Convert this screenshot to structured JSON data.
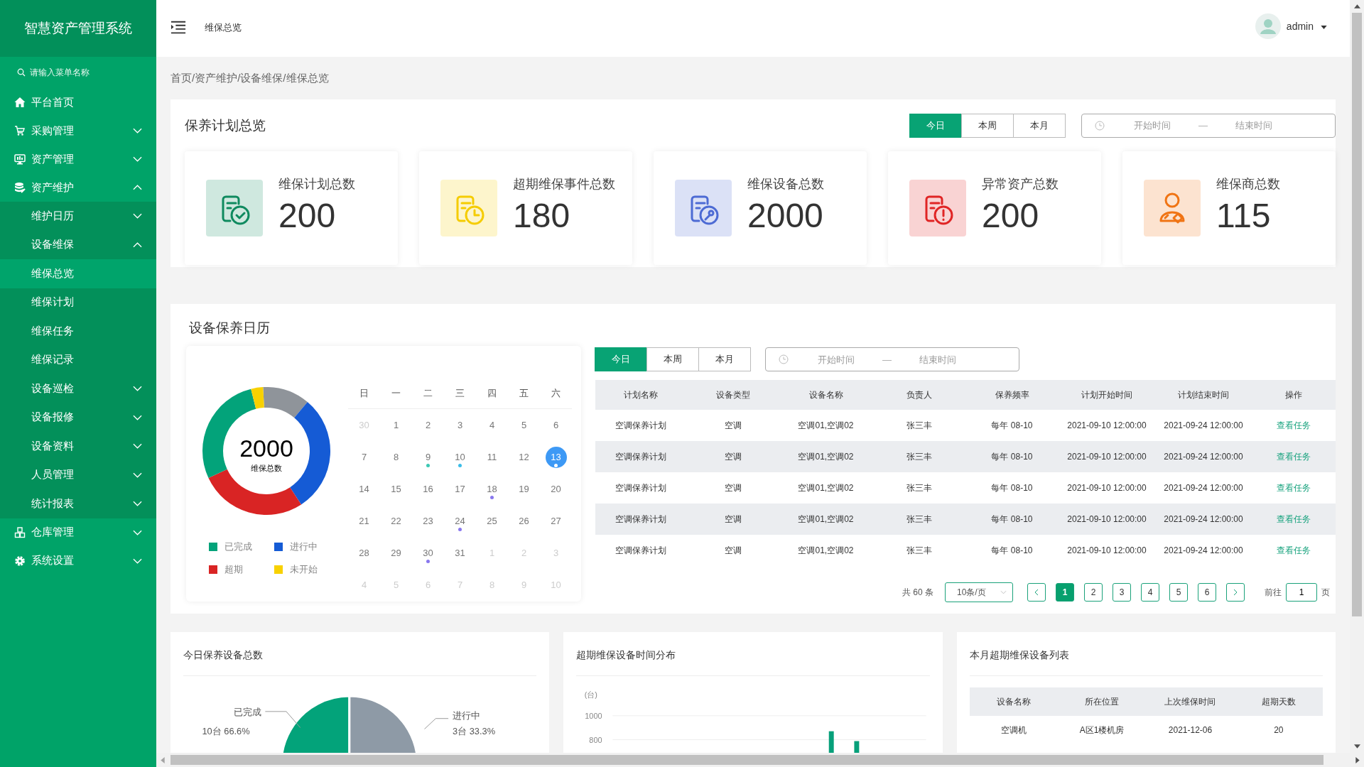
{
  "sidebar": {
    "title": "智慧资产管理系统",
    "search": {
      "placeholder": "请输入菜单名称"
    },
    "items": [
      {
        "label": "平台首页"
      },
      {
        "label": "采购管理",
        "expanded": false
      },
      {
        "label": "资产管理",
        "expanded": false
      },
      {
        "label": "资产维护",
        "expanded": true,
        "children": [
          {
            "label": "维护日历",
            "expanded": false
          },
          {
            "label": "设备维保",
            "expanded": true,
            "children": [
              {
                "label": "维保总览",
                "selected": true
              },
              {
                "label": "维保计划",
                "selected": false
              },
              {
                "label": "维保任务",
                "selected": false
              },
              {
                "label": "维保记录",
                "selected": false
              }
            ]
          },
          {
            "label": "设备巡检",
            "expanded": false
          },
          {
            "label": "设备报修",
            "expanded": false
          },
          {
            "label": "设备资料",
            "expanded": false
          },
          {
            "label": "人员管理",
            "expanded": false
          },
          {
            "label": "统计报表",
            "expanded": false
          }
        ]
      },
      {
        "label": "仓库管理",
        "expanded": false
      },
      {
        "label": "系统设置",
        "expanded": false
      }
    ]
  },
  "header": {
    "title": "维保总览",
    "user": "admin"
  },
  "breadcrumb": "首页/资产维护/设备维保/维保总览",
  "overview": {
    "title": "保养计划总览",
    "tabs": [
      {
        "label": "今日",
        "selected": true
      },
      {
        "label": "本周",
        "selected": false
      },
      {
        "label": "本月",
        "selected": false
      }
    ],
    "date_range": {
      "start_placeholder": "开始时间",
      "separator": "—",
      "end_placeholder": "结束时间"
    },
    "cards": [
      {
        "label": "维保计划总数",
        "value": "200",
        "color": "#0f8a5f"
      },
      {
        "label": "超期维保事件总数",
        "value": "180",
        "color": "#f5cc00"
      },
      {
        "label": "维保设备总数",
        "value": "2000",
        "color": "#4d6bd4"
      },
      {
        "label": "异常资产总数",
        "value": "200",
        "color": "#e02525"
      },
      {
        "label": "维保商总数",
        "value": "115",
        "color": "#f07414"
      }
    ]
  },
  "calendar_panel": {
    "title": "设备保养日历",
    "donut": {
      "total": "2000",
      "caption": "维保总数",
      "legend": [
        {
          "label": "已完成",
          "color": "#03a37a"
        },
        {
          "label": "进行中",
          "color": "#155bd5"
        },
        {
          "label": "超期",
          "color": "#d92424"
        },
        {
          "label": "未开始",
          "color": "#f8d100"
        }
      ]
    },
    "weekdays": [
      "日",
      "一",
      "二",
      "三",
      "四",
      "五",
      "六"
    ],
    "days": [
      {
        "label": "30",
        "muted": true,
        "selected": false
      },
      {
        "label": "1",
        "muted": false,
        "selected": false
      },
      {
        "label": "2",
        "muted": false,
        "selected": false
      },
      {
        "label": "3",
        "muted": false,
        "selected": false
      },
      {
        "label": "4",
        "muted": false,
        "selected": false
      },
      {
        "label": "5",
        "muted": false,
        "selected": false
      },
      {
        "label": "6",
        "muted": false,
        "selected": false
      },
      {
        "label": "7",
        "muted": false,
        "selected": false
      },
      {
        "label": "8",
        "muted": false,
        "selected": false
      },
      {
        "label": "9",
        "muted": false,
        "selected": false,
        "color": "#3cc8b4"
      },
      {
        "label": "10",
        "muted": false,
        "selected": false,
        "color": "#3bbde8"
      },
      {
        "label": "11",
        "muted": false,
        "selected": false
      },
      {
        "label": "12",
        "muted": false,
        "selected": false
      },
      {
        "label": "13",
        "muted": false,
        "selected": true,
        "color": "#ffffff"
      },
      {
        "label": "14",
        "muted": false,
        "selected": false
      },
      {
        "label": "15",
        "muted": false,
        "selected": false
      },
      {
        "label": "16",
        "muted": false,
        "selected": false
      },
      {
        "label": "17",
        "muted": false,
        "selected": false
      },
      {
        "label": "18",
        "muted": false,
        "selected": false,
        "color": "#8877ee"
      },
      {
        "label": "19",
        "muted": false,
        "selected": false
      },
      {
        "label": "20",
        "muted": false,
        "selected": false
      },
      {
        "label": "21",
        "muted": false,
        "selected": false
      },
      {
        "label": "22",
        "muted": false,
        "selected": false
      },
      {
        "label": "23",
        "muted": false,
        "selected": false
      },
      {
        "label": "24",
        "muted": false,
        "selected": false,
        "color": "#8877ee"
      },
      {
        "label": "25",
        "muted": false,
        "selected": false
      },
      {
        "label": "26",
        "muted": false,
        "selected": false
      },
      {
        "label": "27",
        "muted": false,
        "selected": false
      },
      {
        "label": "28",
        "muted": false,
        "selected": false
      },
      {
        "label": "29",
        "muted": false,
        "selected": false
      },
      {
        "label": "30",
        "muted": false,
        "selected": false,
        "color": "#8877ee"
      },
      {
        "label": "31",
        "muted": false,
        "selected": false
      },
      {
        "label": "1",
        "muted": true,
        "selected": false
      },
      {
        "label": "2",
        "muted": true,
        "selected": false
      },
      {
        "label": "3",
        "muted": true,
        "selected": false
      },
      {
        "label": "4",
        "muted": true,
        "selected": false
      },
      {
        "label": "5",
        "muted": true,
        "selected": false
      },
      {
        "label": "6",
        "muted": true,
        "selected": false
      },
      {
        "label": "7",
        "muted": true,
        "selected": false
      },
      {
        "label": "8",
        "muted": true,
        "selected": false
      },
      {
        "label": "9",
        "muted": true,
        "selected": false
      },
      {
        "label": "10",
        "muted": true,
        "selected": false
      }
    ],
    "tabs": [
      {
        "label": "今日",
        "selected": true
      },
      {
        "label": "本周",
        "selected": false
      },
      {
        "label": "本月",
        "selected": false
      }
    ],
    "date_range": {
      "start_placeholder": "开始时间",
      "separator": "—",
      "end_placeholder": "结束时间"
    },
    "table": {
      "columns": [
        "计划名称",
        "设备类型",
        "设备名称",
        "负责人",
        "保养频率",
        "计划开始时间",
        "计划结束时间",
        "操作"
      ],
      "rows": [
        {
          "cells": [
            "空调保养计划",
            "空调",
            "空调01,空调02",
            "张三丰",
            "每年 08-10",
            "2021-09-10 12:00:00",
            "2021-09-24 12:00:00"
          ],
          "action": "查看任务"
        },
        {
          "cells": [
            "空调保养计划",
            "空调",
            "空调01,空调02",
            "张三丰",
            "每年 08-10",
            "2021-09-10 12:00:00",
            "2021-09-24 12:00:00"
          ],
          "action": "查看任务"
        },
        {
          "cells": [
            "空调保养计划",
            "空调",
            "空调01,空调02",
            "张三丰",
            "每年 08-10",
            "2021-09-10 12:00:00",
            "2021-09-24 12:00:00"
          ],
          "action": "查看任务"
        },
        {
          "cells": [
            "空调保养计划",
            "空调",
            "空调01,空调02",
            "张三丰",
            "每年 08-10",
            "2021-09-10 12:00:00",
            "2021-09-24 12:00:00"
          ],
          "action": "查看任务"
        },
        {
          "cells": [
            "空调保养计划",
            "空调",
            "空调01,空调02",
            "张三丰",
            "每年 08-10",
            "2021-09-10 12:00:00",
            "2021-09-24 12:00:00"
          ],
          "action": "查看任务"
        }
      ]
    },
    "pagination": {
      "total": "共 60 条",
      "page_size": "10条/页",
      "pages": [
        {
          "label": "1",
          "selected": true
        },
        {
          "label": "2",
          "selected": false
        },
        {
          "label": "3",
          "selected": false
        },
        {
          "label": "4",
          "selected": false
        },
        {
          "label": "5",
          "selected": false
        },
        {
          "label": "6",
          "selected": false
        }
      ],
      "goto_label": "前往",
      "goto_value": "1",
      "page_suffix": "页"
    }
  },
  "today_card": {
    "title": "今日保养设备总数",
    "chart_data": {
      "type": "pie",
      "categories": [
        "已完成",
        "进行中"
      ],
      "values": [
        66.6,
        33.3
      ],
      "colors": [
        "#03a37a",
        "#8e9aa6"
      ],
      "value_labels": [
        "10台  66.6%",
        "3台 33.3%"
      ]
    }
  },
  "distribution_card": {
    "title": "超期维保设备时间分布",
    "unit": "(台)",
    "y_labels": [
      "1000",
      "800"
    ]
  },
  "overdue_card": {
    "title": "本月超期维保设备列表",
    "columns": [
      "设备名称",
      "所在位置",
      "上次维保时间",
      "超期天数"
    ],
    "rows": [
      [
        "空调机",
        "A区1楼机房",
        "2021-12-06",
        "20"
      ]
    ]
  }
}
